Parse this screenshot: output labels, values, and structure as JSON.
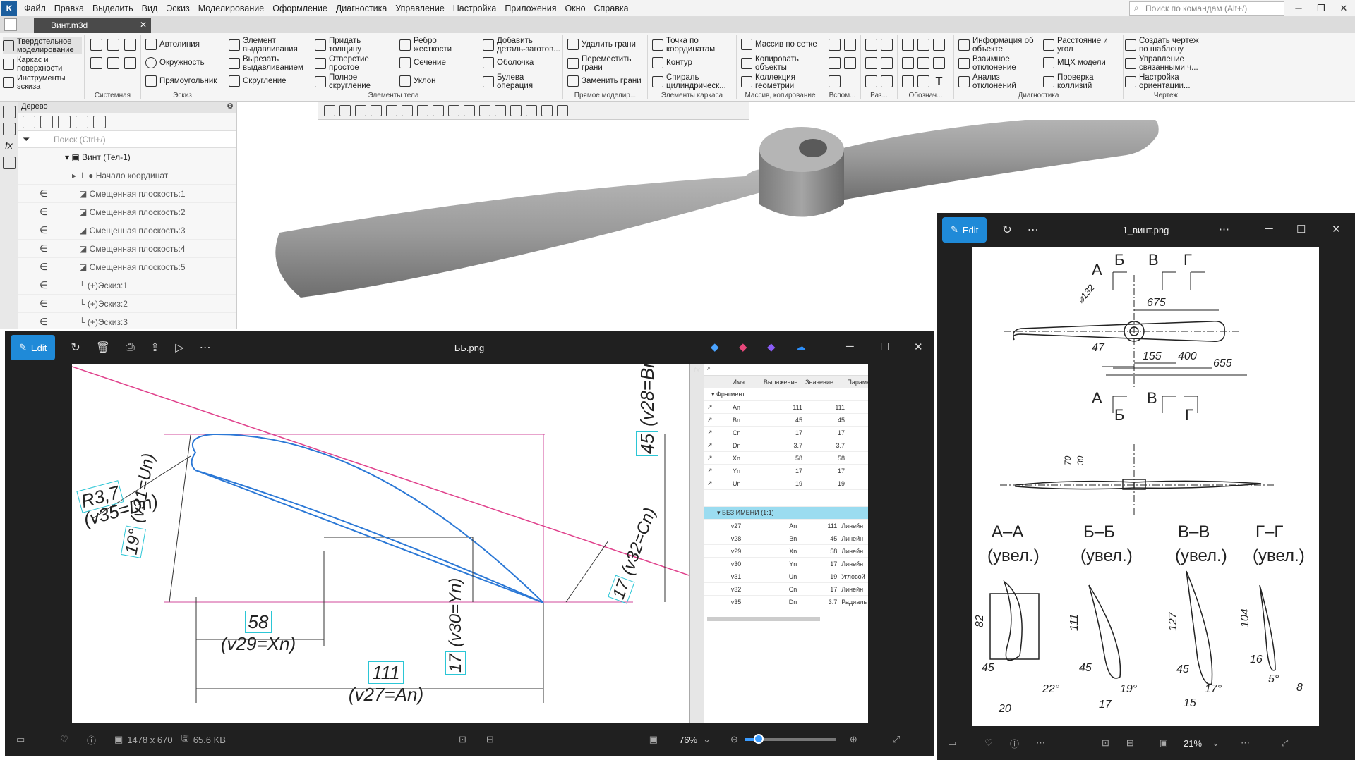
{
  "app": {
    "menu": [
      "Файл",
      "Правка",
      "Выделить",
      "Вид",
      "Эскиз",
      "Моделирование",
      "Оформление",
      "Диагностика",
      "Управление",
      "Настройка",
      "Приложения",
      "Окно",
      "Справка"
    ],
    "command_search_placeholder": "Поиск по командам (Alt+/)",
    "document_tab": "Винт.m3d"
  },
  "ribbon": {
    "modes": [
      "Твердотельное моделирование",
      "Каркас и поверхности",
      "Инструменты эскиза"
    ],
    "groups": [
      {
        "caption": "Системная"
      },
      {
        "caption": "Эскиз",
        "buttons": [
          "Автолиния",
          "Окружность",
          "Прямоугольник"
        ]
      },
      {
        "caption": "Элементы тела",
        "buttons": [
          "Элемент выдавливания",
          "Вырезать выдавливанием",
          "Скругление",
          "Придать толщину",
          "Отверстие простое",
          "Полное скругление",
          "Ребро жесткости",
          "Сечение",
          "Уклон",
          "Добавить деталь-заготов...",
          "Оболочка",
          "Булева операция"
        ]
      },
      {
        "caption": "Прямое моделир...",
        "buttons": [
          "Удалить грани",
          "Переместить грани",
          "Заменить грани"
        ]
      },
      {
        "caption": "Элементы каркаса",
        "buttons": [
          "Точка по координатам",
          "Контур",
          "Спираль цилиндрическ..."
        ]
      },
      {
        "caption": "Массив, копирование",
        "buttons": [
          "Массив по сетке",
          "Копировать объекты",
          "Коллекция геометрии"
        ]
      },
      {
        "caption": "Вспом..."
      },
      {
        "caption": "Раз..."
      },
      {
        "caption": "Обознач..."
      },
      {
        "caption": "Диагностика",
        "buttons": [
          "Информация об объекте",
          "Взаимное отклонение",
          "Анализ отклонений",
          "Расстояние и угол",
          "МЦХ модели",
          "Проверка коллизий"
        ]
      },
      {
        "caption": "Чертеж",
        "buttons": [
          "Создать чертеж по шаблону",
          "Управление связанными ч...",
          "Настройка ориентации..."
        ]
      }
    ]
  },
  "tree": {
    "title": "Дерево",
    "search_placeholder": "Поиск (Ctrl+/)",
    "root": "Винт (Тел-1)",
    "items": [
      "Начало координат",
      "Смещенная плоскость:1",
      "Смещенная плоскость:2",
      "Смещенная плоскость:3",
      "Смещенная плоскость:4",
      "Смещенная плоскость:5",
      "Эскиз:1",
      "Эскиз:2",
      "Эскиз:3"
    ]
  },
  "photo_viewer_1": {
    "edit_label": "Edit",
    "filename": "ББ.png",
    "dims_text": "1478 x 670",
    "size_text": "65.6 KB",
    "zoom": "76%",
    "sketch_labels": {
      "r": "R3,7",
      "r_expr": "(v35=Dn)",
      "angle": "19°",
      "angle_expr": "(v31=Un)",
      "d58": "58",
      "d58_expr": "(v29=Xn)",
      "d111": "111",
      "d111_expr": "(v27=An)",
      "d17a": "17",
      "d17a_expr": "(v30=Yn)",
      "d17b": "17",
      "d17b_expr": "(v32=Cn)",
      "d45": "45",
      "d45_expr": "(v28=Bn)"
    },
    "var_table": {
      "headers": [
        "Имя",
        "Выражение",
        "Значение",
        "Парамет"
      ],
      "section1": "Фрагмент",
      "rows1": [
        [
          "An",
          "111",
          "111"
        ],
        [
          "Bn",
          "45",
          "45"
        ],
        [
          "Cn",
          "17",
          "17"
        ],
        [
          "Dn",
          "3.7",
          "3.7"
        ],
        [
          "Xn",
          "58",
          "58"
        ],
        [
          "Yn",
          "17",
          "17"
        ],
        [
          "Un",
          "19",
          "19"
        ]
      ],
      "section2": "БЕЗ ИМЕНИ (1:1)",
      "rows2": [
        [
          "v27",
          "An",
          "111",
          "Линейн"
        ],
        [
          "v28",
          "Bn",
          "45",
          "Линейн"
        ],
        [
          "v29",
          "Xn",
          "58",
          "Линейн"
        ],
        [
          "v30",
          "Yn",
          "17",
          "Линейн"
        ],
        [
          "v31",
          "Un",
          "19",
          "Угловой"
        ],
        [
          "v32",
          "Cn",
          "17",
          "Линейн"
        ],
        [
          "v35",
          "Dn",
          "3.7",
          "Радиаль"
        ]
      ]
    }
  },
  "photo_viewer_2": {
    "edit_label": "Edit",
    "filename": "1_винт.png",
    "zoom": "21%",
    "drawing_labels": {
      "sections_top": [
        "А",
        "Б",
        "В",
        "Г"
      ],
      "sections_bottom": [
        "А",
        "Б",
        "В",
        "Г"
      ],
      "diam": "⌀132",
      "d675": "675",
      "d47": "47",
      "d155": "155",
      "d400": "400",
      "d655": "655",
      "d70": "70",
      "d30": "30",
      "sec_aa": "А–А",
      "sec_bb": "Б–Б",
      "sec_vv": "В–В",
      "sec_gg": "Г–Г",
      "enlarged": "(увел.)",
      "aa_h": "82",
      "aa_w": "45",
      "aa_ang": "22°",
      "aa_b": "20",
      "bb_h": "111",
      "bb_w": "45",
      "bb_ang": "19°",
      "bb_b": "17",
      "vv_h": "127",
      "vv_w": "45",
      "vv_ang": "17°",
      "vv_b": "15",
      "gg_h": "104",
      "gg_w": "16",
      "gg_ang": "5°",
      "gg_b": "8"
    }
  }
}
